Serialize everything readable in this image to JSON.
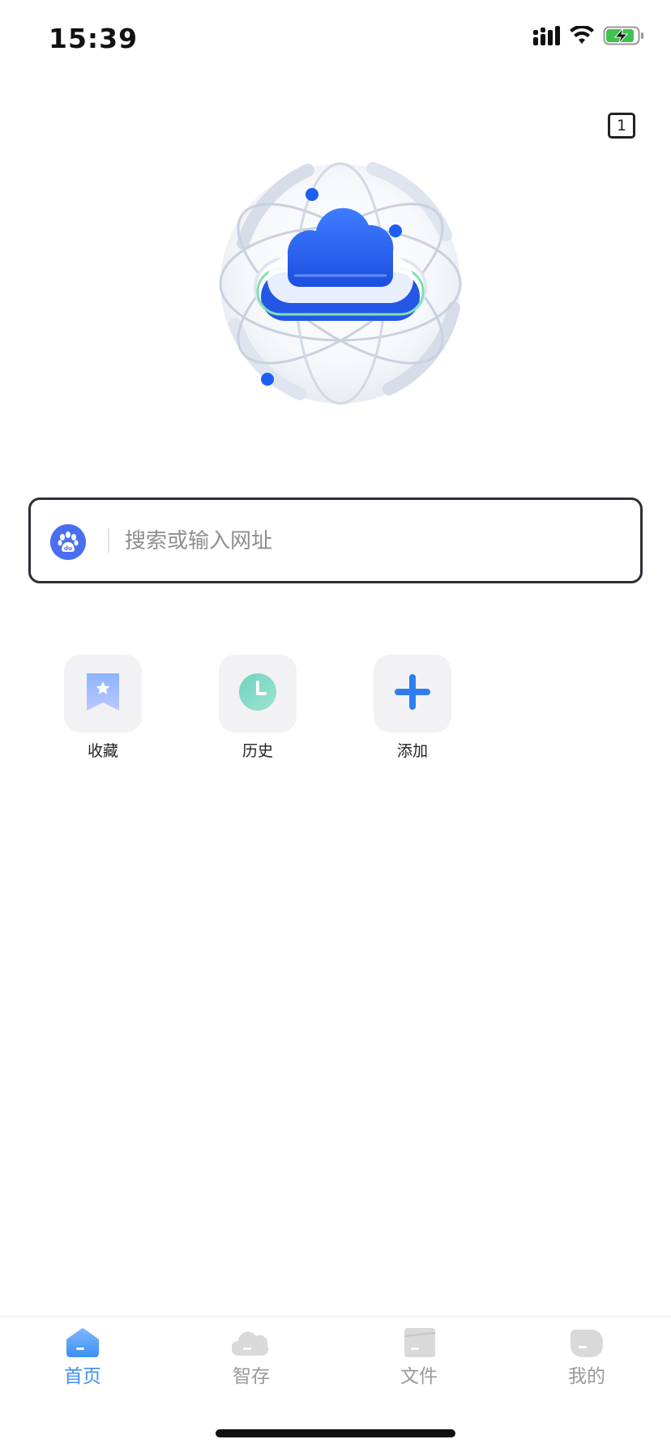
{
  "status_bar": {
    "time": "15:39",
    "icons": [
      "cellular-signal-icon",
      "wifi-icon",
      "battery-charging-icon"
    ],
    "battery_color": "#3fc24f"
  },
  "tab_counter": {
    "count": "1"
  },
  "hero": {
    "icon": "cloud-globe-logo",
    "accent_color": "#2a62f0"
  },
  "search": {
    "engine_icon": "baidu-paw-icon",
    "engine_color": "#4a6ef0",
    "placeholder": "搜索或输入网址",
    "value": ""
  },
  "shortcuts": [
    {
      "label": "收藏",
      "icon": "bookmark-star-icon"
    },
    {
      "label": "历史",
      "icon": "clock-icon"
    },
    {
      "label": "添加",
      "icon": "plus-icon"
    }
  ],
  "bottom_nav": {
    "items": [
      {
        "label": "首页",
        "icon": "home-icon",
        "active": true
      },
      {
        "label": "智存",
        "icon": "cloud-storage-icon",
        "active": false
      },
      {
        "label": "文件",
        "icon": "file-icon",
        "active": false
      },
      {
        "label": "我的",
        "icon": "profile-icon",
        "active": false
      }
    ],
    "active_color": "#3d8ff2",
    "inactive_color": "#9a9a9a"
  }
}
